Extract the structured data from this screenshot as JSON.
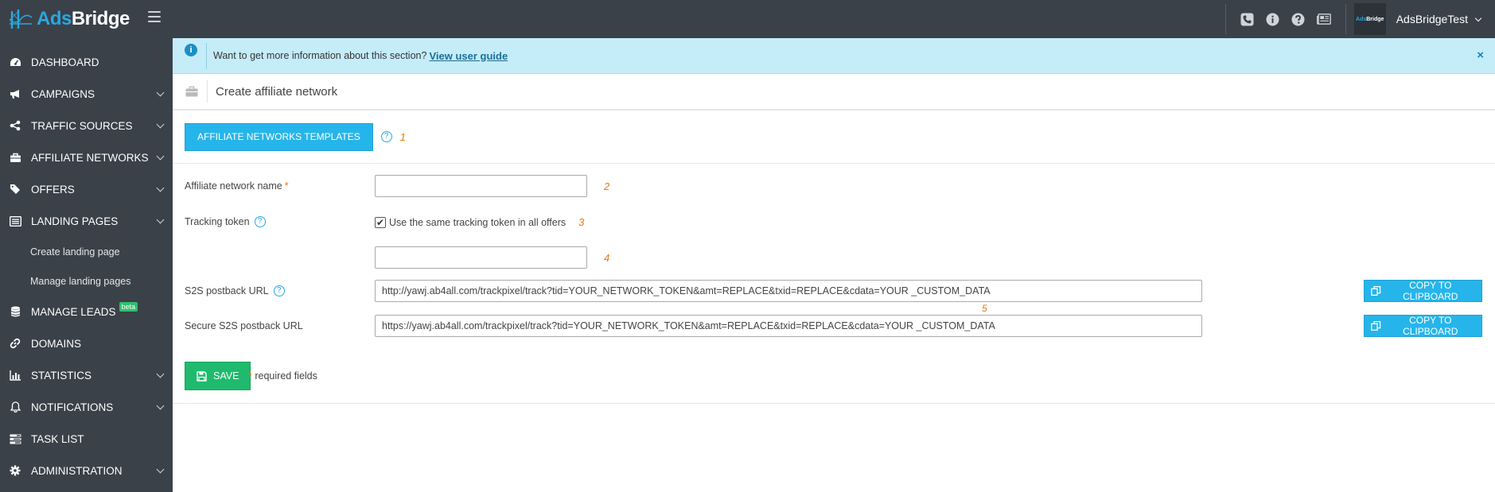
{
  "app": {
    "logo_ads": "Ads",
    "logo_bridge": "Bridge"
  },
  "sidebar": {
    "items": [
      {
        "label": "DASHBOARD",
        "icon": "dashboard-icon",
        "expandable": false
      },
      {
        "label": "CAMPAIGNS",
        "icon": "megaphone-icon",
        "expandable": true
      },
      {
        "label": "TRAFFIC SOURCES",
        "icon": "share-icon",
        "expandable": true
      },
      {
        "label": "AFFILIATE NETWORKS",
        "icon": "briefcase-icon",
        "expandable": true
      },
      {
        "label": "OFFERS",
        "icon": "tags-icon",
        "expandable": true
      },
      {
        "label": "LANDING PAGES",
        "icon": "list-alt-icon",
        "expandable": true
      },
      {
        "label": "MANAGE LEADS",
        "icon": "database-icon",
        "expandable": false,
        "badge": "beta"
      },
      {
        "label": "DOMAINS",
        "icon": "link-icon",
        "expandable": false
      },
      {
        "label": "STATISTICS",
        "icon": "bar-chart-icon",
        "expandable": true
      },
      {
        "label": "NOTIFICATIONS",
        "icon": "bell-icon",
        "expandable": true
      },
      {
        "label": "TASK LIST",
        "icon": "tasks-icon",
        "expandable": false
      },
      {
        "label": "ADMINISTRATION",
        "icon": "gear-icon",
        "expandable": true
      }
    ],
    "subitems": {
      "create_landing_page": "Create landing page",
      "manage_landing_pages": "Manage landing pages"
    }
  },
  "header": {
    "icons": [
      "phone-icon",
      "info-icon",
      "question-icon",
      "newspaper-icon"
    ],
    "username": "AdsBridgeTest"
  },
  "info_bar": {
    "text": "Want to get more information about this section?",
    "link": "View user guide",
    "close": "×"
  },
  "page": {
    "title": "Create affiliate network"
  },
  "templates": {
    "button_label": "AFFILIATE NETWORKS TEMPLATES",
    "marker": "1"
  },
  "form": {
    "name_label": "Affiliate network name",
    "required_mark": "*",
    "name_value": "",
    "name_marker": "2",
    "tracking_label": "Tracking token",
    "tracking_checkbox_label": "Use the same tracking token in all offers",
    "tracking_checked": true,
    "tracking_marker": "3",
    "tracking_value": "",
    "tracking_input_marker": "4",
    "s2s_label": "S2S postback URL",
    "s2s_value": "http://yawj.ab4all.com/trackpixel/track?tid=YOUR_NETWORK_TOKEN&amt=REPLACE&txid=REPLACE&cdata=YOUR _CUSTOM_DATA",
    "secure_label": "Secure S2S postback URL",
    "secure_value": "https://yawj.ab4all.com/trackpixel/track?tid=YOUR_NETWORK_TOKEN&amt=REPLACE&txid=REPLACE&cdata=YOUR _CUSTOM_DATA",
    "url_marker": "5",
    "copy_label": "COPY TO CLIPBOARD",
    "save_label": "SAVE",
    "required_note": "required fields"
  },
  "colors": {
    "sidebar_bg": "#3a4149",
    "accent_blue": "#26b5ea",
    "save_green": "#1fba6d",
    "info_bg": "#c5ecf9",
    "marker_orange": "#e8780c"
  }
}
